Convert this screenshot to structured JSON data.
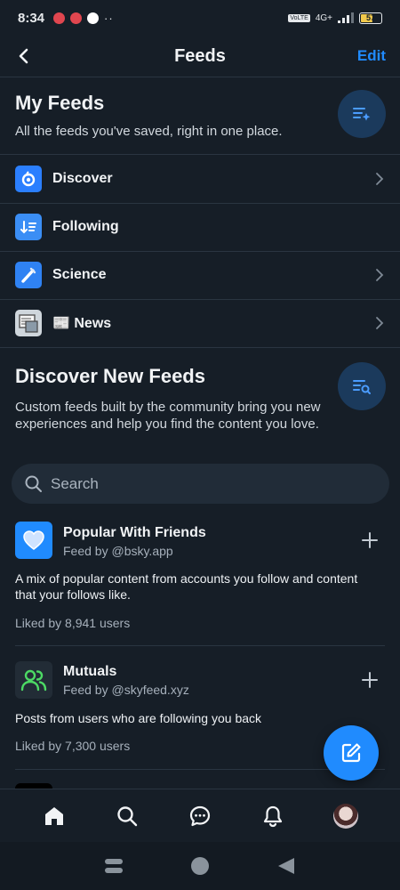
{
  "status_bar": {
    "time": "8:34",
    "network": "4G+",
    "battery": "57",
    "notification_colors": [
      "#e0464f",
      "#e0464f",
      "#ffffff"
    ]
  },
  "header": {
    "title": "Feeds",
    "edit_label": "Edit"
  },
  "my_feeds": {
    "title": "My Feeds",
    "description": "All the feeds you've saved, right in one place.",
    "items": [
      {
        "label": "Discover",
        "icon": "discover-butterfly-icon",
        "color": "#2b7fff"
      },
      {
        "label": "Following",
        "icon": "following-list-icon",
        "color": "#3b8ef5"
      },
      {
        "label": "Science",
        "icon": "science-pipette-icon",
        "color": "#2f82f3"
      },
      {
        "label": "📰 News",
        "icon": "news-image-icon",
        "color": "#cfd6dc"
      }
    ]
  },
  "discover": {
    "title": "Discover New Feeds",
    "description": "Custom feeds built by the community bring you new experiences and help you find the content you love.",
    "search_placeholder": "Search"
  },
  "suggested_feeds": [
    {
      "name": "Popular With Friends",
      "by": "Feed by @bsky.app",
      "description": "A mix of popular content from accounts you follow and content that your follows like.",
      "likes": "Liked by 8,941 users",
      "avatar_color": "#208bfe"
    },
    {
      "name": "Mutuals",
      "by": "Feed by @skyfeed.xyz",
      "description": "Posts from users who are following you back",
      "likes": "Liked by 7,300 users",
      "avatar_color": "#222c36"
    }
  ],
  "colors": {
    "background": "#161e27",
    "accent": "#208bfe",
    "divider": "#2a3541"
  },
  "bottom_nav": [
    "home-icon",
    "search-icon",
    "chat-icon",
    "notifications-bell-icon",
    "profile-avatar"
  ]
}
